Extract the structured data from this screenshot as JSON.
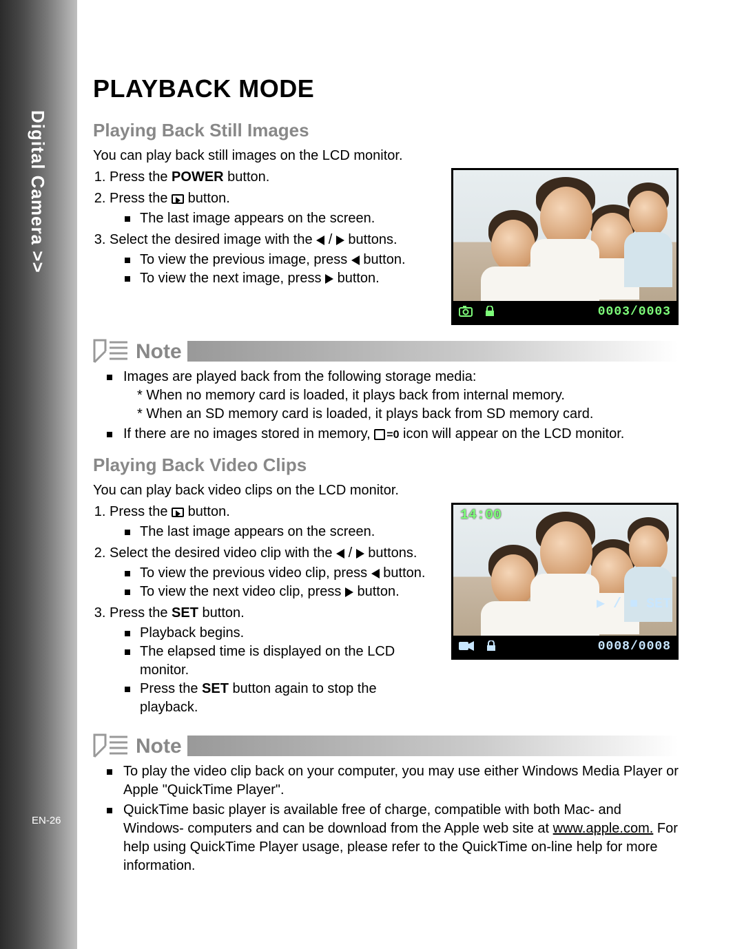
{
  "sidebar": {
    "label": "Digital Camera >>",
    "page_number": "EN-26"
  },
  "title": "PLAYBACK MODE",
  "sec_still": {
    "heading": "Playing Back Still Images",
    "lead": "You can play back still images on the LCD monitor.",
    "step1_pre": "Press the ",
    "step1_bold": "POWER",
    "step1_post": " button.",
    "step2_pre": "Press the ",
    "step2_post": " button.",
    "step2_a": "The last image appears on the screen.",
    "step3_pre": "Select the desired image with the ",
    "step3_mid": " / ",
    "step3_post": " buttons.",
    "step3_a_pre": "To view the previous image, press ",
    "step3_a_post": " button.",
    "step3_b_pre": "To view the next image, press ",
    "step3_b_post": " button.",
    "lcd": {
      "counter_l": "0003",
      "counter_sep": " / ",
      "counter_r": "0003"
    }
  },
  "note1": {
    "label": "Note",
    "li1": "Images are played back from the following storage media:",
    "li1a": "When no memory card is loaded, it plays back from internal memory.",
    "li1b": "When an SD memory card is loaded, it plays back from SD memory card.",
    "li2_pre": "If there are no images stored in memory, ",
    "li2_suffix": "=0",
    "li2_post": " icon will appear on the LCD monitor."
  },
  "sec_video": {
    "heading": "Playing Back Video Clips",
    "lead": "You can play back video clips on the LCD monitor.",
    "step1_pre": "Press the ",
    "step1_post": " button.",
    "step1_a": "The last image appears on the screen.",
    "step2_pre": "Select the desired video clip with the ",
    "step2_mid": " / ",
    "step2_post": " buttons.",
    "step2_a_pre": "To view the previous video clip, press ",
    "step2_a_post": " button.",
    "step2_b_pre": "To view the next video clip, press ",
    "step2_b_post": " button.",
    "step3_pre": "Press the ",
    "step3_bold": "SET",
    "step3_post": " button.",
    "step3_a": "Playback begins.",
    "step3_b": "The elapsed time is displayed on the LCD monitor.",
    "step3_c_pre": "Press the ",
    "step3_c_bold": "SET",
    "step3_c_post": " button again to stop the playback.",
    "lcd": {
      "time": "14:00",
      "set_label": "▶ / ■  SET",
      "counter_l": "0008",
      "counter_sep": "/",
      "counter_r": "0008"
    }
  },
  "note2": {
    "label": "Note",
    "li1": "To play the video clip back on your computer, you may use either Windows Media Player or Apple \"QuickTime Player\".",
    "li2_pre": "QuickTime basic player is available free of charge, compatible with both Mac- and Windows- computers and can be download from the Apple web site at ",
    "li2_link": "www.apple.com.",
    "li2_post": " For help using QuickTime Player usage, please refer to the QuickTime on-line help for more information."
  }
}
